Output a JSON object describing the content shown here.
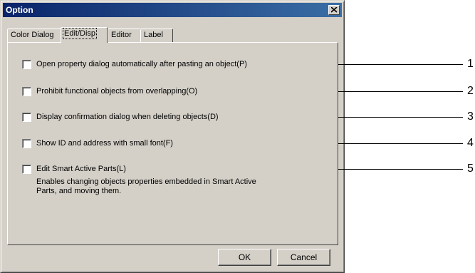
{
  "window": {
    "title": "Option"
  },
  "tabs": [
    {
      "label": "Color Dialog"
    },
    {
      "label": "Edit/Disp"
    },
    {
      "label": "Editor"
    },
    {
      "label": "Label"
    }
  ],
  "options": [
    {
      "label": "Open property dialog automatically after pasting an object(P)",
      "checked": false
    },
    {
      "label": "Prohibit functional objects from overlapping(O)",
      "checked": false
    },
    {
      "label": "Display confirmation dialog when deleting objects(D)",
      "checked": false
    },
    {
      "label": "Show ID and address with small font(F)",
      "checked": false
    },
    {
      "label": "Edit Smart Active Parts(L)",
      "checked": false
    }
  ],
  "description": "Enables changing objects properties embedded in Smart Active Parts, and moving them.",
  "buttons": {
    "ok": "OK",
    "cancel": "Cancel"
  },
  "callouts": [
    "1",
    "2",
    "3",
    "4",
    "5"
  ]
}
